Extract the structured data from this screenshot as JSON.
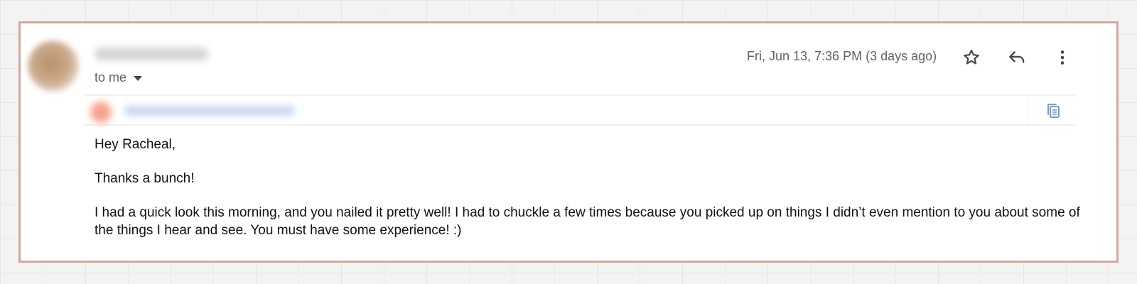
{
  "email": {
    "recipient_label": "to me",
    "date": "Fri, Jun 13, 7:36 PM (3 days ago)",
    "greeting": "Hey Racheal,",
    "line_thanks": "Thanks a bunch!",
    "paragraph": "I had a quick look this morning, and you nailed it pretty well! I had to chuckle a few times because you picked up on things I didn’t even mention to you about some of the things I hear and see. You must have some experience! :)"
  },
  "icons": {
    "star": "star-outline-icon",
    "reply": "reply-icon",
    "more": "more-vertical-icon",
    "dropdown": "caret-down-icon",
    "copy": "copy-icon"
  },
  "colors": {
    "frame_border": "#d2a7a0",
    "meta_text": "#5f6368",
    "body_text": "#111111",
    "copy_icon": "#7b9cc9"
  }
}
